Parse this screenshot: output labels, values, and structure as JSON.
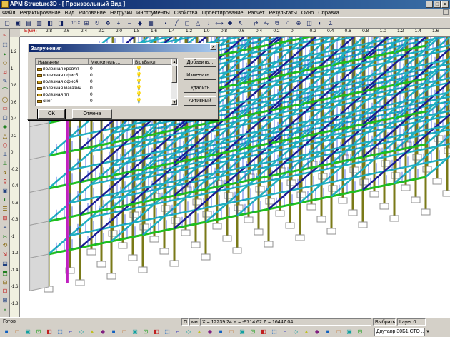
{
  "window": {
    "title": "APM Structure3D - [ Произвольный Вид ]"
  },
  "menu": [
    "Файл",
    "Редактирование",
    "Вид",
    "Рисование",
    "Нагрузки",
    "Инструменты",
    "Свойства",
    "Проектирование",
    "Расчет",
    "Результаты",
    "Окно",
    "Справка"
  ],
  "toolbar": {
    "icons": [
      "new-icon",
      "open-icon",
      "save-icon",
      "print-icon",
      "copy-icon",
      "paste-icon",
      "zoom-1x-icon",
      "zoom-window-icon",
      "rotate-icon",
      "pan-icon",
      "zoom-in-icon",
      "zoom-out-icon",
      "view-3d-icon",
      "grid-icon",
      "node-icon",
      "bar-icon",
      "plate-icon",
      "support-icon",
      "load-icon",
      "measure-icon",
      "axis-icon",
      "select-icon",
      "move-icon",
      "mirror-icon",
      "copy-obj-icon",
      "array-icon",
      "snap-icon",
      "section-icon",
      "render-icon",
      "calc-icon"
    ],
    "zoom_label": "1:1X"
  },
  "ruler": {
    "x_ticks": [
      "2.8",
      "2.6",
      "2.4",
      "2.2",
      "2.0",
      "1.8",
      "1.6",
      "1.4",
      "1.2",
      "1.0",
      "0.8",
      "0.6",
      "0.4",
      "0.2",
      "0",
      "-0.2",
      "-0.4",
      "-0.6",
      "-0.8",
      "-1.0",
      "-1.2",
      "-1.4",
      "-1.6"
    ],
    "unit_label": "E(мм)",
    "y_ticks": [
      "1.2",
      "1",
      "0.8",
      "0.6",
      "0.4",
      "0.2",
      "0",
      "-0.2",
      "-0.4",
      "-0.6",
      "-0.8",
      "-1",
      "-1.2",
      "-1.4",
      "-1.6",
      "-1.8"
    ]
  },
  "dialog": {
    "title": "Загружения",
    "columns": [
      "Название",
      "Множитель ...",
      "Вкл/Выкл"
    ],
    "rows": [
      {
        "name": "полезная кровля",
        "factor": "0",
        "state": "💡"
      },
      {
        "name": "полезная офис5",
        "factor": "0",
        "state": "💡"
      },
      {
        "name": "полезная офис4",
        "factor": "0",
        "state": "💡"
      },
      {
        "name": "полезная магазин",
        "factor": "0",
        "state": "💡"
      },
      {
        "name": "полезная тп",
        "factor": "0",
        "state": "💡"
      },
      {
        "name": "снег",
        "factor": "0",
        "state": "💡"
      }
    ],
    "buttons": {
      "add": "Добавить...",
      "edit": "Изменить...",
      "delete": "Удалить",
      "active": "Активный",
      "ok": "OK",
      "cancel": "Отмена"
    }
  },
  "status": {
    "ready": "Готов",
    "p": "П",
    "mn": "мн",
    "coords": "X = 12239.24 Y = -9714.62 Z = 16447.04",
    "mode": "Выбрать",
    "layer": "Layer 0"
  },
  "bottom": {
    "section_combo": "Двутавр 30Б1 СТО ..."
  },
  "colors": {
    "title_bar": "#0a246a",
    "loads": "#1a3ad8",
    "column": "#7a7a18",
    "beam_green": "#1ec01e",
    "beam_cyan": "#20b0c0",
    "beam_navy": "#1a1a90",
    "slab_grey": "#a0a0a0",
    "support_grey": "#909090",
    "magenta": "#c020c0"
  }
}
